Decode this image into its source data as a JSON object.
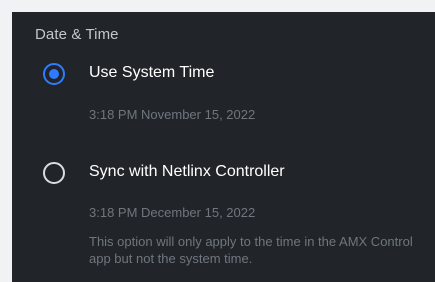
{
  "section": {
    "title": "Date & Time"
  },
  "options": [
    {
      "label": "Use System Time",
      "time": "3:18 PM November 15, 2022",
      "selected": true
    },
    {
      "label": "Sync with Netlinx Controller",
      "time": "3:18 PM December 15, 2022",
      "note": "This option will only apply to the time in the AMX Control app but not the system time.",
      "selected": false
    }
  ],
  "colors": {
    "panel_background": "#212529",
    "accent": "#2f7bff",
    "primary_text": "#ffffff",
    "secondary_text": "#6f767e",
    "section_title": "#c2c7cd"
  }
}
